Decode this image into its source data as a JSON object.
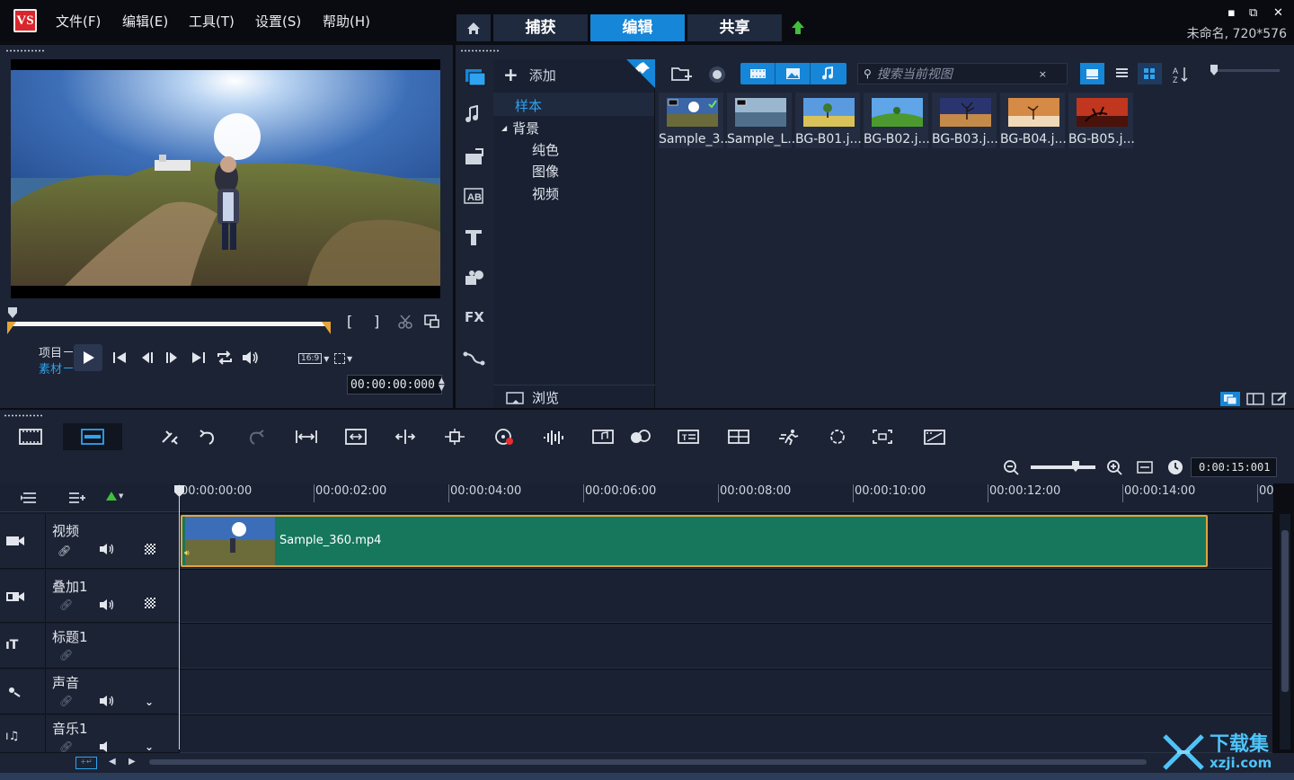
{
  "app": {
    "logo_text": "VS"
  },
  "menu": [
    {
      "label": "文件(F)"
    },
    {
      "label": "编辑(E)"
    },
    {
      "label": "工具(T)"
    },
    {
      "label": "设置(S)"
    },
    {
      "label": "帮助(H)"
    }
  ],
  "tabs": [
    {
      "label": "捕获"
    },
    {
      "label": "编辑"
    },
    {
      "label": "共享"
    }
  ],
  "active_tab": "编辑",
  "project": {
    "info": "未命名, 720*576"
  },
  "window_buttons": {
    "minimize": "▪",
    "restore": "⧉",
    "close": "✕"
  },
  "preview": {
    "mode_project": "项目",
    "mode_clip": "素材",
    "aspect": "16:9",
    "timecode": "00:00:00:000",
    "mark_in": "[",
    "mark_out": "]"
  },
  "library": {
    "add_label": "添加",
    "search_placeholder": "搜索当前视图",
    "browse_label": "浏览",
    "tree": [
      {
        "label": "样本",
        "level": 0,
        "selected": true
      },
      {
        "label": "背景",
        "level": 0,
        "expanded": true
      },
      {
        "label": "纯色",
        "level": 1
      },
      {
        "label": "图像",
        "level": 1
      },
      {
        "label": "视频",
        "level": 1
      }
    ],
    "thumbnails": [
      {
        "label": "Sample_3...",
        "kind": "video"
      },
      {
        "label": "Sample_L...",
        "kind": "video"
      },
      {
        "label": "BG-B01.j...",
        "kind": "image"
      },
      {
        "label": "BG-B02.j...",
        "kind": "image"
      },
      {
        "label": "BG-B03.j...",
        "kind": "image"
      },
      {
        "label": "BG-B04.j...",
        "kind": "image"
      },
      {
        "label": "BG-B05.j...",
        "kind": "image"
      }
    ],
    "side_icons": [
      "media-icon",
      "audio-icon",
      "instant-project-icon",
      "transition-icon",
      "title-icon",
      "graphic-icon",
      "filter-icon",
      "path-icon"
    ],
    "fx_label": "FX"
  },
  "timeline": {
    "zoom_timecode": "0:00:15:001",
    "ruler": [
      "00:00:00:00",
      "00:00:02:00",
      "00:00:04:00",
      "00:00:06:00",
      "00:00:08:00",
      "00:00:10:00",
      "00:00:12:00",
      "00:00:14:00",
      "00"
    ],
    "tracks": [
      {
        "name": "视频"
      },
      {
        "name": "叠加1"
      },
      {
        "name": "标题1"
      },
      {
        "name": "声音"
      },
      {
        "name": "音乐1"
      }
    ],
    "clip": {
      "name": "Sample_360.mp4"
    }
  },
  "watermark": {
    "text": "下载集",
    "url": "xzji.com"
  },
  "colors": {
    "accent": "#1586d8",
    "panel": "#1c2334",
    "clip": "#16775d",
    "clip_border": "#e3a43a"
  }
}
